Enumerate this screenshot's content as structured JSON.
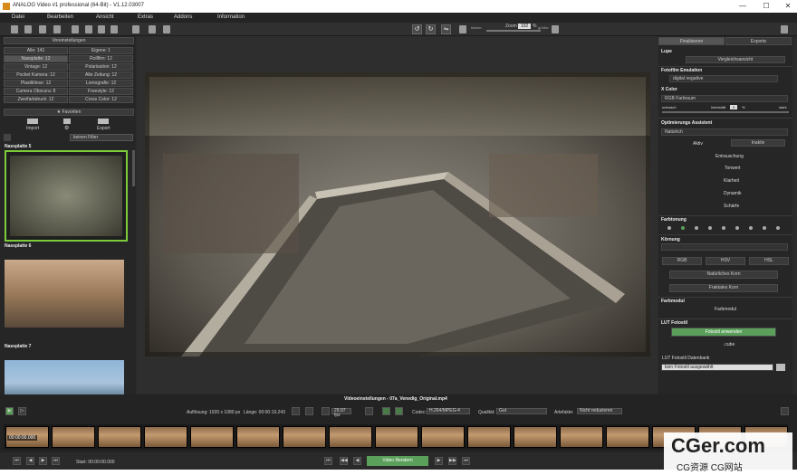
{
  "window": {
    "title": "ANALOG Video #1 professional (64-Bit) - V1.12.03007",
    "minimize": "—",
    "maximize": "☐",
    "close": "✕"
  },
  "menu": [
    "Datei",
    "Bearbeiten",
    "Ansicht",
    "Extras",
    "Addons",
    "Information"
  ],
  "toolbar": {
    "zoom_label": "Zoom",
    "zoom_value": "102",
    "zoom_unit": "%",
    "small_label": "kleiner",
    "big_label": "größer"
  },
  "left_panel": {
    "presets_header": "Voreinstellungen",
    "grid": [
      [
        "Alle: 141",
        "Eigene: 1"
      ],
      [
        "Nassplatte: 12",
        "Rollfilm: 12"
      ],
      [
        "Vintage: 12",
        "Polarisation: 12"
      ],
      [
        "Pocket Kamera: 12",
        "Alte Zeitung: 12"
      ],
      [
        "Plastiklinse: 12",
        "Lomografie: 12"
      ],
      [
        "Camera Obscura: 8",
        "Freestyle: 12"
      ],
      [
        "Zweifarbdruck: 12",
        "Cross Color: 12"
      ]
    ],
    "favorites": "★ Favoriten",
    "import_label": "Import",
    "export_label": "Export",
    "filter_value": "keinen Filter",
    "thumbs": [
      "Nassplatte 5",
      "Nassplatte 6",
      "Nassplatte 7"
    ]
  },
  "right_panel": {
    "tab_finalize": "Finalisieren",
    "tab_export": "Exporte",
    "lupe": "Lupe",
    "compare": "Vergleichsansicht",
    "film_emulation": "Fotofilm Emulation",
    "film_value": "digital negative",
    "xcolor": "X Color",
    "xcolor_value": "RGB Farbraum",
    "weak": "schwach",
    "intensity": "Intensität",
    "intensity_value": "0",
    "intensity_unit": "%",
    "strong": "stark",
    "assist": "Optimierungs Assistent",
    "assist_value": "Natürlich",
    "active": "Aktiv",
    "inactive": "Inaktiv",
    "tools": [
      "Entrauschung",
      "Tonwert",
      "Klarheit",
      "Dynamik",
      "Schärfe"
    ],
    "toning": "Farbtonung",
    "grain": "Körnung",
    "rgb": "RGB",
    "hsv": "HSV",
    "hsl": "HSL",
    "natural_grain": "Natürliches Korn",
    "fractal_grain": "Fraktales Korn",
    "color_module": "Farbmodul",
    "color_module_btn": "Farbmodul",
    "lut_style": "LUT Fotostil",
    "lut_btn": "Fotostil anwenden",
    "cube": ".cube",
    "lut_db": "LUT Fotostil Datenbank",
    "lut_db_value": "kein Fotostil ausgewählt"
  },
  "video": {
    "title": "Videoeinstellungen - 07a_Venedig_Original.mp4",
    "resolution": "Auflösung: 1920 x 1080 px",
    "length": "Länge: 00:00:19.243",
    "fps": "29,97 fps",
    "codec_label": "Codec:",
    "codec_value": "H.264/MPEG-4",
    "quality_label": "Qualität:",
    "quality_value": "Gut",
    "artifacts_label": "Artefakte:",
    "artifacts_value": "Nicht reduzieren",
    "timestamp": "00:00:00.000",
    "start": "Start: 00:00:00.000",
    "render_btn": "Video Rendern"
  },
  "watermark": {
    "title": "CGer.com",
    "subtitle": "CG资源 CG网站"
  },
  "colors": {
    "accent_green": "#5aa05a",
    "panel_bg": "#262626",
    "active_border": "#7ccc3a"
  }
}
